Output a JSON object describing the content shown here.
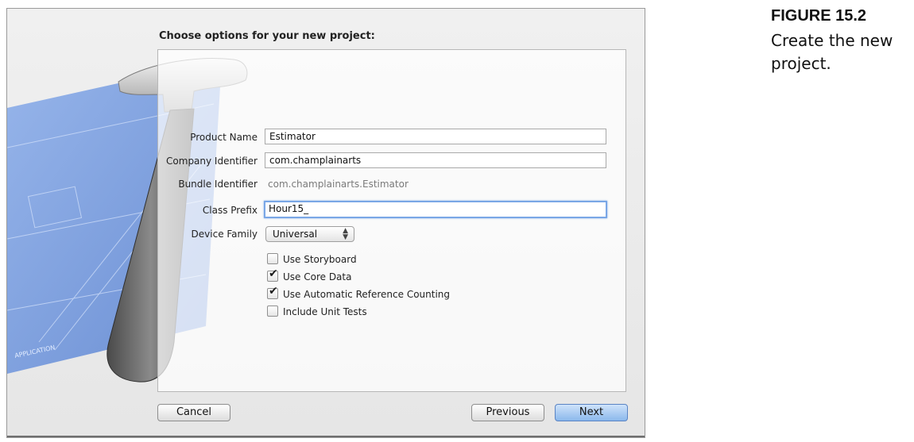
{
  "dialog": {
    "heading": "Choose options for your new project:",
    "fields": {
      "product_name": {
        "label": "Product Name",
        "value": "Estimator"
      },
      "company_identifier": {
        "label": "Company Identifier",
        "value": "com.champlainarts"
      },
      "bundle_identifier": {
        "label": "Bundle Identifier",
        "value": "com.champlainarts.Estimator"
      },
      "class_prefix": {
        "label": "Class Prefix",
        "value": "Hour15_"
      },
      "device_family": {
        "label": "Device Family",
        "value": "Universal"
      }
    },
    "checkboxes": [
      {
        "label": "Use Storyboard",
        "checked": false
      },
      {
        "label": "Use Core Data",
        "checked": true
      },
      {
        "label": "Use Automatic Reference Counting",
        "checked": true
      },
      {
        "label": "Include Unit Tests",
        "checked": false
      }
    ],
    "buttons": {
      "cancel": "Cancel",
      "previous": "Previous",
      "next": "Next"
    },
    "background_text": "APPLICATION"
  },
  "figure": {
    "number": "FIGURE 15.2",
    "caption": "Create the new project."
  },
  "colors": {
    "accent": "#7aa7e6",
    "blueprint": "#6f93d8",
    "primary_button": "#8bb8ec"
  }
}
